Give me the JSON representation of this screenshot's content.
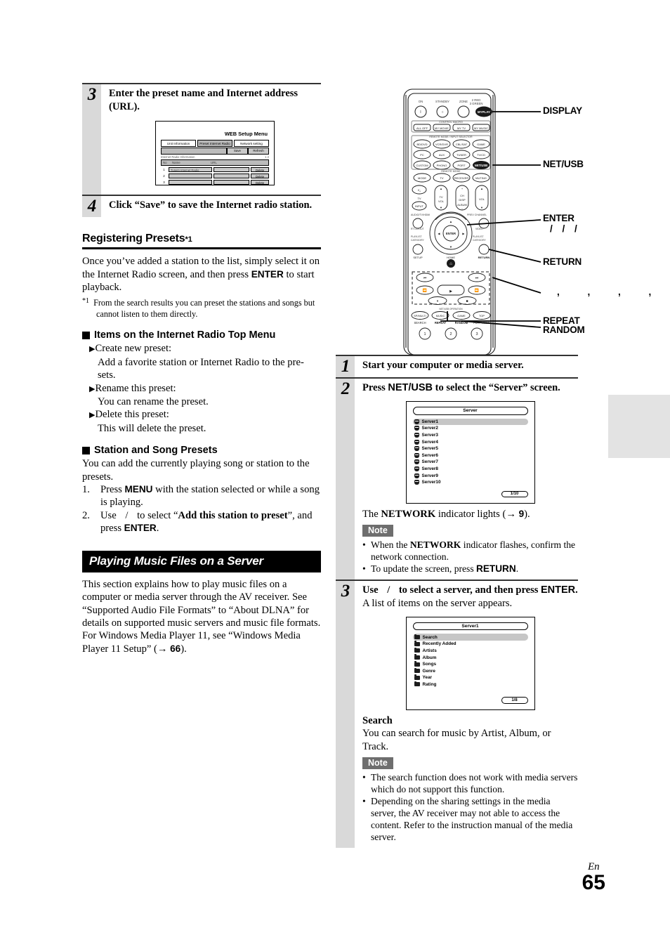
{
  "left_column": {
    "step3": {
      "number": "3",
      "title": "Enter the preset name and Internet address (URL).",
      "figure": {
        "title": "WEB Setup Menu",
        "tabs": [
          "Unit Information",
          "Preset Internet Radio",
          "Network setting"
        ],
        "buttons": [
          "Save",
          "Refresh"
        ],
        "info_label": "Internet Radio Information",
        "page_indicator": "1   2",
        "columns": [
          "No",
          "Name",
          "URL"
        ],
        "rows": [
          {
            "no": "1",
            "name": "TuneIn Internet Radio",
            "url": "",
            "action": "Delete"
          },
          {
            "no": "2",
            "name": "",
            "url": "",
            "action": "Delete"
          },
          {
            "no": "3",
            "name": "",
            "url": "",
            "action": "Delete"
          }
        ]
      }
    },
    "step4": {
      "number": "4",
      "title": "Click “Save” to save the Internet radio station."
    },
    "registering_presets": {
      "heading": "Registering Presets",
      "heading_sup": "*1",
      "body": "Once you’ve added a station to the list, simply select it on the Internet Radio screen, and then press ENTER to start playback.",
      "body_part1": "Once you’ve added a station to the list, simply select it on the Internet Radio screen, and then press ",
      "body_enter": "ENTER",
      "body_part2": " to start playback.",
      "footnote_marker": "*1",
      "footnote": "From the search results you can preset the stations and songs but cannot listen to them directly."
    },
    "items_menu": {
      "heading": "Items on the Internet Radio Top Menu",
      "items": [
        {
          "label": "Create new preset:",
          "desc": "Add a favorite station or Internet Radio to the pre-sets."
        },
        {
          "label": "Rename this preset:",
          "desc": "You can rename the preset."
        },
        {
          "label": "Delete this preset:",
          "desc": "This will delete the preset."
        }
      ]
    },
    "station_song_presets": {
      "heading": "Station and Song Presets",
      "intro": "You can add the currently playing song or station to the presets.",
      "steps": [
        {
          "n": "1.",
          "pre": "Press ",
          "key": "MENU",
          "post": " with the station selected or while a song is playing."
        },
        {
          "n": "2.",
          "pre": "Use ",
          "keys": "/",
          "mid": " to select “",
          "bold": "Add this station to preset",
          "post": "”, and press ",
          "key2": "ENTER",
          "end": "."
        }
      ]
    },
    "playing_music": {
      "section_title": "Playing Music Files on a Server",
      "para1": "This section explains how to play music files on a computer or media server through the AV receiver. See “Supported Audio File Formats” to “About DLNA” for details on supported music servers and music file formats.",
      "para2_pre": "For Windows Media Player 11, see “Windows Media Player 11 Setup” (",
      "para2_arrow": "→",
      "para2_page": "66",
      "para2_post": ")."
    }
  },
  "remote": {
    "top_labels": [
      "ON",
      "STANDBY",
      "ZONE"
    ],
    "zone_sub": [
      "2 RED",
      "3 GREEN"
    ],
    "display_button": "MY PLAY",
    "control_group_label": "CONTROL MACRO",
    "macro_buttons": [
      "ALL OFF",
      "MY MOVIE",
      "MY TV",
      "MY MUSIC"
    ],
    "input_selector_label": "REMOTE MODE / INPUT SELECTOR",
    "input_buttons": [
      [
        "BD/DVD",
        "VCR/DVR",
        "CBL/SAT",
        "GAME"
      ],
      [
        "PC",
        "AUX",
        "TUNER",
        "TV/CD"
      ],
      [
        "CUSTOM",
        "PHONO",
        "PORT",
        "NET/USB"
      ]
    ],
    "remote_mode_label": "REMOTE MODE",
    "mode_buttons": [
      "MODE",
      "TV",
      "RECEIVER",
      "MUTING"
    ],
    "volume_labels": [
      "TV",
      "INPUT",
      "TV VOL",
      "CH DISP",
      "ALBUM",
      "VOL"
    ],
    "nav_center": "ENTER",
    "nav_side_labels": [
      "AUDIO/TV/HDMI",
      "PREV CHANNEL",
      "RT LAYOUT",
      "VIDEO",
      "PLAYLIST CATEGORY",
      "SETUP",
      "RETURN",
      "HOME"
    ],
    "bottom_labels": [
      "SEARCH",
      "REPEAT",
      "RANDOM",
      "PLAY MODE"
    ],
    "bottom_button_labels": [
      "SP/MULTI",
      "MUSIC",
      "GAME",
      "TOP"
    ],
    "number_keys": [
      "1",
      "2",
      "3"
    ],
    "callouts": [
      {
        "label": "DISPLAY",
        "sub": ""
      },
      {
        "label": "NET/USB",
        "sub": ""
      },
      {
        "label": "ENTER",
        "sub": "/  /  /"
      },
      {
        "label": "RETURN",
        "sub": ""
      },
      {
        "label": "",
        "sub": ",    ,    ,          ,"
      },
      {
        "label": "REPEAT",
        "sub": ""
      },
      {
        "label": "RANDOM",
        "sub": ""
      }
    ]
  },
  "right_column": {
    "step1": {
      "number": "1",
      "title": "Start your computer or media server."
    },
    "step2": {
      "number": "2",
      "title_pre": "Press ",
      "title_key": "NET/USB",
      "title_post": " to select the “Server” screen.",
      "osd": {
        "title": "Server",
        "items": [
          "Server1",
          "Server2",
          "Server3",
          "Server4",
          "Server5",
          "Server6",
          "Server7",
          "Server8",
          "Server9",
          "Server10"
        ],
        "selected_index": 0,
        "page": "1/10"
      },
      "after_pre": "The ",
      "after_key": "NETWORK",
      "after_mid": " indicator lights (",
      "after_arrow": "→",
      "after_page": "9",
      "after_post": ").",
      "note_label": "Note",
      "notes": [
        "When the NETWORK indicator flashes, confirm the network connection.",
        "To update the screen, press RETURN."
      ],
      "note1_pre": "When the ",
      "note1_key": "NETWORK",
      "note1_post": " indicator flashes, confirm the network connection.",
      "note2_pre": "To update the screen, press ",
      "note2_key": "RETURN",
      "note2_post": "."
    },
    "step3": {
      "number": "3",
      "title_pre": "Use ",
      "title_keys": "/",
      "title_mid": " to select a server, and then press ",
      "title_key": "ENTER",
      "title_post": ".",
      "subtitle": "A list of items on the server appears.",
      "osd": {
        "title": "Server1",
        "items": [
          "Search",
          "Recently Added",
          "Artists",
          "Album",
          "Songs",
          "Genre",
          "Year",
          "Rating"
        ],
        "selected_index": 0,
        "page": "1/8"
      },
      "search_heading": "Search",
      "search_body": "You can search for music by Artist, Album, or Track.",
      "note_label": "Note",
      "notes": [
        "The search function does not work with media servers which do not support this function.",
        "Depending on the sharing settings in the media server, the AV receiver may not able to access the content. Refer to the instruction manual of the media server."
      ]
    }
  },
  "footer": {
    "lang": "En",
    "page_number": "65"
  }
}
